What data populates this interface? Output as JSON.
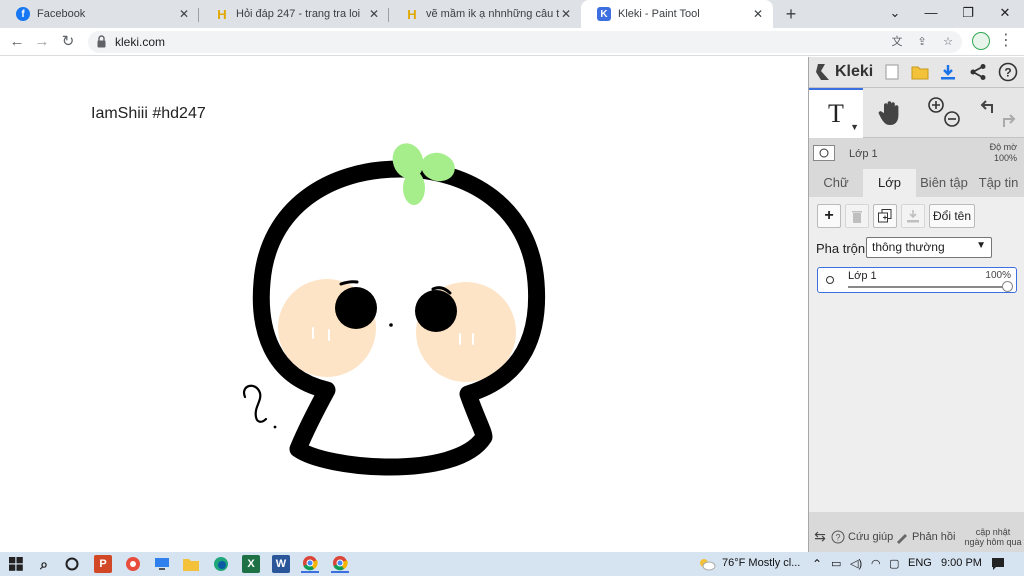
{
  "browser": {
    "tabs": [
      {
        "title": "Facebook",
        "favicon": "facebook-icon",
        "active": false
      },
      {
        "title": "Hỏi đáp 247 - trang tra loi",
        "favicon": "hoidap247-icon",
        "active": false
      },
      {
        "title": "vẽ mầm ik ạ nhnhững câu tt có thể",
        "favicon": "hoidap247-icon",
        "active": false
      },
      {
        "title": "Kleki - Paint Tool",
        "favicon": "kleki-icon",
        "active": true
      }
    ],
    "close_glyph": "✕",
    "new_tab_glyph": "+",
    "window_controls": {
      "chevron": "⌄",
      "minimize": "—",
      "restore": "❐",
      "close": "✕"
    },
    "url": "kleki.com"
  },
  "canvas": {
    "caption": "IamShiii #hd247"
  },
  "kleki": {
    "logo": "Kleki",
    "tool_text_glyph": "T",
    "layer_header": {
      "name": "Lớp 1",
      "opacity_label": "Độ mờ",
      "opacity_value": "100%"
    },
    "tabs": [
      "Chữ",
      "Lớp",
      "Biên tập",
      "Tập tin"
    ],
    "selected_tab": "Lớp",
    "layer_buttons": {
      "add": "+",
      "rename": "Đổi tên"
    },
    "blend_label": "Pha trộn",
    "blend_value": "thông thường",
    "layer": {
      "name": "Lớp 1",
      "opacity": "100%",
      "opacity_fraction": 1.0
    },
    "bottom": {
      "help": "Cứu giúp",
      "feedback": "Phản hồi",
      "update_line1": "cập nhật",
      "update_line2": "ngày hôm qua"
    }
  },
  "taskbar": {
    "weather": "76°F  Mostly cl...",
    "language": "ENG",
    "time": "9:00 PM"
  }
}
